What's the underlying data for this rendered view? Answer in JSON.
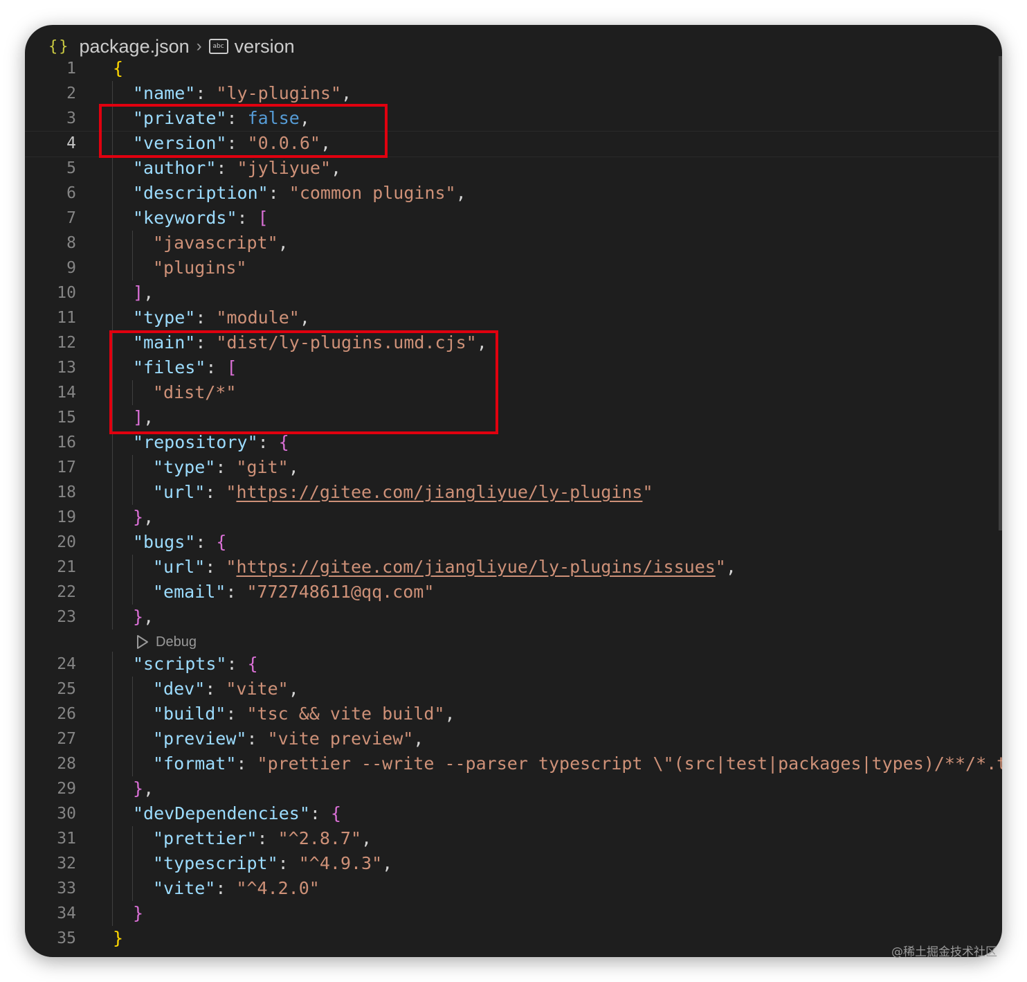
{
  "breadcrumb": {
    "file_icon": "{}",
    "file": "package.json",
    "separator": "›",
    "symbol_icon": "abc",
    "symbol": "version"
  },
  "editor": {
    "active_line": 4,
    "codelens_debug": "Debug"
  },
  "watermark": "@稀土掘金技术社区",
  "lines": [
    {
      "n": "1",
      "tokens": [
        {
          "t": "{",
          "c": "y"
        }
      ]
    },
    {
      "n": "2",
      "indent": 1,
      "tokens": [
        {
          "t": "\"name\"",
          "c": "k"
        },
        {
          "t": ": ",
          "c": "p"
        },
        {
          "t": "\"ly-plugins\"",
          "c": "s"
        },
        {
          "t": ",",
          "c": "p"
        }
      ]
    },
    {
      "n": "3",
      "indent": 1,
      "tokens": [
        {
          "t": "\"private\"",
          "c": "k"
        },
        {
          "t": ": ",
          "c": "p"
        },
        {
          "t": "false",
          "c": "b"
        },
        {
          "t": ",",
          "c": "p"
        }
      ]
    },
    {
      "n": "4",
      "indent": 1,
      "tokens": [
        {
          "t": "\"version\"",
          "c": "k"
        },
        {
          "t": ": ",
          "c": "p"
        },
        {
          "t": "\"0.0.6\"",
          "c": "s"
        },
        {
          "t": ",",
          "c": "p"
        }
      ]
    },
    {
      "n": "5",
      "indent": 1,
      "tokens": [
        {
          "t": "\"author\"",
          "c": "k"
        },
        {
          "t": ": ",
          "c": "p"
        },
        {
          "t": "\"jyliyue\"",
          "c": "s"
        },
        {
          "t": ",",
          "c": "p"
        }
      ]
    },
    {
      "n": "6",
      "indent": 1,
      "tokens": [
        {
          "t": "\"description\"",
          "c": "k"
        },
        {
          "t": ": ",
          "c": "p"
        },
        {
          "t": "\"common plugins\"",
          "c": "s"
        },
        {
          "t": ",",
          "c": "p"
        }
      ]
    },
    {
      "n": "7",
      "indent": 1,
      "tokens": [
        {
          "t": "\"keywords\"",
          "c": "k"
        },
        {
          "t": ": ",
          "c": "p"
        },
        {
          "t": "[",
          "c": "m"
        }
      ]
    },
    {
      "n": "8",
      "indent": 2,
      "tokens": [
        {
          "t": "\"javascript\"",
          "c": "s"
        },
        {
          "t": ",",
          "c": "p"
        }
      ]
    },
    {
      "n": "9",
      "indent": 2,
      "tokens": [
        {
          "t": "\"plugins\"",
          "c": "s"
        }
      ]
    },
    {
      "n": "10",
      "indent": 1,
      "tokens": [
        {
          "t": "]",
          "c": "m"
        },
        {
          "t": ",",
          "c": "p"
        }
      ]
    },
    {
      "n": "11",
      "indent": 1,
      "tokens": [
        {
          "t": "\"type\"",
          "c": "k"
        },
        {
          "t": ": ",
          "c": "p"
        },
        {
          "t": "\"module\"",
          "c": "s"
        },
        {
          "t": ",",
          "c": "p"
        }
      ]
    },
    {
      "n": "12",
      "indent": 1,
      "tokens": [
        {
          "t": "\"main\"",
          "c": "k"
        },
        {
          "t": ": ",
          "c": "p"
        },
        {
          "t": "\"dist/ly-plugins.umd.cjs\"",
          "c": "s"
        },
        {
          "t": ",",
          "c": "p"
        }
      ]
    },
    {
      "n": "13",
      "indent": 1,
      "tokens": [
        {
          "t": "\"files\"",
          "c": "k"
        },
        {
          "t": ": ",
          "c": "p"
        },
        {
          "t": "[",
          "c": "m"
        }
      ]
    },
    {
      "n": "14",
      "indent": 2,
      "tokens": [
        {
          "t": "\"dist/*\"",
          "c": "s"
        }
      ]
    },
    {
      "n": "15",
      "indent": 1,
      "tokens": [
        {
          "t": "]",
          "c": "m"
        },
        {
          "t": ",",
          "c": "p"
        }
      ]
    },
    {
      "n": "16",
      "indent": 1,
      "tokens": [
        {
          "t": "\"repository\"",
          "c": "k"
        },
        {
          "t": ": ",
          "c": "p"
        },
        {
          "t": "{",
          "c": "m"
        }
      ]
    },
    {
      "n": "17",
      "indent": 2,
      "tokens": [
        {
          "t": "\"type\"",
          "c": "k"
        },
        {
          "t": ": ",
          "c": "p"
        },
        {
          "t": "\"git\"",
          "c": "s"
        },
        {
          "t": ",",
          "c": "p"
        }
      ]
    },
    {
      "n": "18",
      "indent": 2,
      "tokens": [
        {
          "t": "\"url\"",
          "c": "k"
        },
        {
          "t": ": ",
          "c": "p"
        },
        {
          "t": "\"",
          "c": "s"
        },
        {
          "t": "https://gitee.com/jiangliyue/ly-plugins",
          "c": "s u"
        },
        {
          "t": "\"",
          "c": "s"
        }
      ]
    },
    {
      "n": "19",
      "indent": 1,
      "tokens": [
        {
          "t": "}",
          "c": "m"
        },
        {
          "t": ",",
          "c": "p"
        }
      ]
    },
    {
      "n": "20",
      "indent": 1,
      "tokens": [
        {
          "t": "\"bugs\"",
          "c": "k"
        },
        {
          "t": ": ",
          "c": "p"
        },
        {
          "t": "{",
          "c": "m"
        }
      ]
    },
    {
      "n": "21",
      "indent": 2,
      "tokens": [
        {
          "t": "\"url\"",
          "c": "k"
        },
        {
          "t": ": ",
          "c": "p"
        },
        {
          "t": "\"",
          "c": "s"
        },
        {
          "t": "https://gitee.com/jiangliyue/ly-plugins/issues",
          "c": "s u"
        },
        {
          "t": "\"",
          "c": "s"
        },
        {
          "t": ",",
          "c": "p"
        }
      ]
    },
    {
      "n": "22",
      "indent": 2,
      "tokens": [
        {
          "t": "\"email\"",
          "c": "k"
        },
        {
          "t": ": ",
          "c": "p"
        },
        {
          "t": "\"772748611@qq.com\"",
          "c": "s"
        }
      ]
    },
    {
      "n": "23",
      "indent": 1,
      "tokens": [
        {
          "t": "}",
          "c": "m"
        },
        {
          "t": ",",
          "c": "p"
        }
      ]
    },
    {
      "n": "24",
      "indent": 1,
      "tokens": [
        {
          "t": "\"scripts\"",
          "c": "k"
        },
        {
          "t": ": ",
          "c": "p"
        },
        {
          "t": "{",
          "c": "m"
        }
      ]
    },
    {
      "n": "25",
      "indent": 2,
      "tokens": [
        {
          "t": "\"dev\"",
          "c": "k"
        },
        {
          "t": ": ",
          "c": "p"
        },
        {
          "t": "\"vite\"",
          "c": "s"
        },
        {
          "t": ",",
          "c": "p"
        }
      ]
    },
    {
      "n": "26",
      "indent": 2,
      "tokens": [
        {
          "t": "\"build\"",
          "c": "k"
        },
        {
          "t": ": ",
          "c": "p"
        },
        {
          "t": "\"tsc && vite build\"",
          "c": "s"
        },
        {
          "t": ",",
          "c": "p"
        }
      ]
    },
    {
      "n": "27",
      "indent": 2,
      "tokens": [
        {
          "t": "\"preview\"",
          "c": "k"
        },
        {
          "t": ": ",
          "c": "p"
        },
        {
          "t": "\"vite preview\"",
          "c": "s"
        },
        {
          "t": ",",
          "c": "p"
        }
      ]
    },
    {
      "n": "28",
      "indent": 2,
      "tokens": [
        {
          "t": "\"format\"",
          "c": "k"
        },
        {
          "t": ": ",
          "c": "p"
        },
        {
          "t": "\"prettier --write --parser typescript \\\"(src|test|packages|types)/**/*.ts\\\"",
          "c": "s"
        }
      ]
    },
    {
      "n": "29",
      "indent": 1,
      "tokens": [
        {
          "t": "}",
          "c": "m"
        },
        {
          "t": ",",
          "c": "p"
        }
      ]
    },
    {
      "n": "30",
      "indent": 1,
      "tokens": [
        {
          "t": "\"devDependencies\"",
          "c": "k"
        },
        {
          "t": ": ",
          "c": "p"
        },
        {
          "t": "{",
          "c": "m"
        }
      ]
    },
    {
      "n": "31",
      "indent": 2,
      "tokens": [
        {
          "t": "\"prettier\"",
          "c": "k"
        },
        {
          "t": ": ",
          "c": "p"
        },
        {
          "t": "\"^2.8.7\"",
          "c": "s"
        },
        {
          "t": ",",
          "c": "p"
        }
      ]
    },
    {
      "n": "32",
      "indent": 2,
      "tokens": [
        {
          "t": "\"typescript\"",
          "c": "k"
        },
        {
          "t": ": ",
          "c": "p"
        },
        {
          "t": "\"^4.9.3\"",
          "c": "s"
        },
        {
          "t": ",",
          "c": "p"
        }
      ]
    },
    {
      "n": "33",
      "indent": 2,
      "tokens": [
        {
          "t": "\"vite\"",
          "c": "k"
        },
        {
          "t": ": ",
          "c": "p"
        },
        {
          "t": "\"^4.2.0\"",
          "c": "s"
        }
      ]
    },
    {
      "n": "34",
      "indent": 1,
      "tokens": [
        {
          "t": "}",
          "c": "m"
        }
      ]
    },
    {
      "n": "35",
      "tokens": [
        {
          "t": "}",
          "c": "y"
        }
      ]
    }
  ]
}
